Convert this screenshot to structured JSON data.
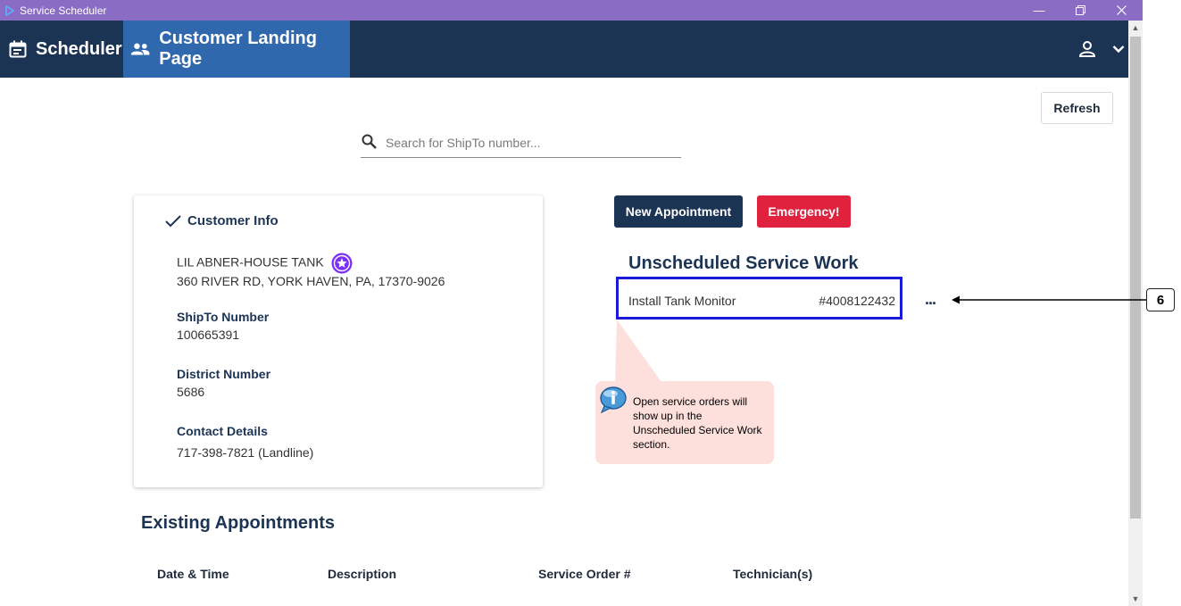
{
  "window": {
    "title": "Service Scheduler"
  },
  "nav": {
    "scheduler": "Scheduler",
    "landing": "Customer Landing Page"
  },
  "toolbar": {
    "refresh": "Refresh"
  },
  "search": {
    "placeholder": "Search for ShipTo number..."
  },
  "customer": {
    "title": "Customer Info",
    "name": "LIL ABNER-HOUSE TANK",
    "address": "360 RIVER RD, YORK HAVEN, PA, 17370-9026",
    "shipto_label": "ShipTo Number",
    "shipto": "100665391",
    "district_label": "District Number",
    "district": "5686",
    "contact_label": "Contact Details",
    "contact": "717-398-7821 (Landline)"
  },
  "actions": {
    "new_appointment": "New Appointment",
    "emergency": "Emergency!"
  },
  "unscheduled": {
    "title": "Unscheduled Service Work",
    "items": [
      {
        "description": "Install Tank Monitor",
        "number": "#4008122432"
      }
    ],
    "more": "..."
  },
  "callout": {
    "number": "6"
  },
  "tip": {
    "text": "Open service orders will show up in the Unscheduled Service Work section."
  },
  "appointments": {
    "title": "Existing Appointments",
    "columns": [
      "Date & Time",
      "Description",
      "Service Order #",
      "Technician(s)"
    ]
  },
  "colors": {
    "titlebar": "#8b6cc4",
    "header": "#1c3454",
    "active_tab": "#3068ad",
    "emergency": "#e0223f",
    "highlight": "#1a1ad8",
    "tip_bg": "#fde0dc",
    "badge": "#7b2ff7"
  }
}
